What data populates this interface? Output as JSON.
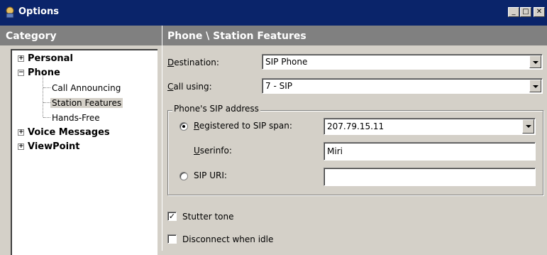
{
  "window": {
    "title": "Options",
    "minimize": "_",
    "maximize": "□",
    "close": "✕"
  },
  "category_panel": {
    "header": "Category",
    "tree": [
      {
        "label": "Personal",
        "expander": "+"
      },
      {
        "label": "Phone",
        "expander": "−"
      },
      {
        "label": "Call Announcing"
      },
      {
        "label": "Station Features"
      },
      {
        "label": "Hands-Free"
      },
      {
        "label": "Voice Messages",
        "expander": "+"
      },
      {
        "label": "ViewPoint",
        "expander": "+"
      }
    ]
  },
  "main": {
    "header": "Phone \\ Station Features",
    "destination": {
      "label_first": "D",
      "label_rest": "estination:",
      "value": "SIP Phone"
    },
    "call_using": {
      "label_first": "C",
      "label_rest": "all using:",
      "value": "7 - SIP"
    },
    "sip_group": {
      "legend": "Phone's SIP address",
      "registered": {
        "label_first": "R",
        "label_rest": "egistered to SIP span:",
        "value": "207.79.15.11"
      },
      "userinfo": {
        "label_first": "U",
        "label_rest": "serinfo:",
        "value": "Miri"
      },
      "sip_uri": {
        "label": "SIP URI:",
        "value": ""
      }
    },
    "stutter_tone": {
      "label": "Stutter tone",
      "checked": "✓"
    },
    "disconnect_idle": {
      "label": "Disconnect when idle"
    }
  }
}
